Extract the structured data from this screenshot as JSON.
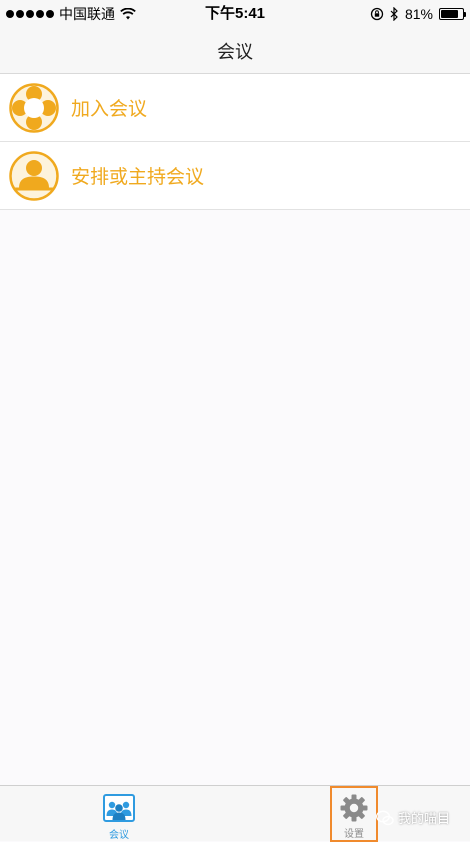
{
  "status_bar": {
    "carrier": "中国联通",
    "time": "下午5:41",
    "battery_percent": "81%",
    "battery_level": 0.81,
    "signal_bars": 5
  },
  "nav": {
    "title": "会议"
  },
  "menu": {
    "items": [
      {
        "label": "加入会议",
        "icon": "join-meeting-icon"
      },
      {
        "label": "安排或主持会议",
        "icon": "host-meeting-icon"
      }
    ]
  },
  "tabs": [
    {
      "label": "会议",
      "icon": "meeting-icon",
      "active": true
    },
    {
      "label": "设置",
      "icon": "gear-icon",
      "active": false,
      "highlighted": true
    }
  ],
  "watermark": {
    "text": "我的喵目"
  },
  "colors": {
    "accent": "#f0a91e",
    "tab_active": "#2f9be0",
    "highlight_border": "#f08a2d"
  }
}
